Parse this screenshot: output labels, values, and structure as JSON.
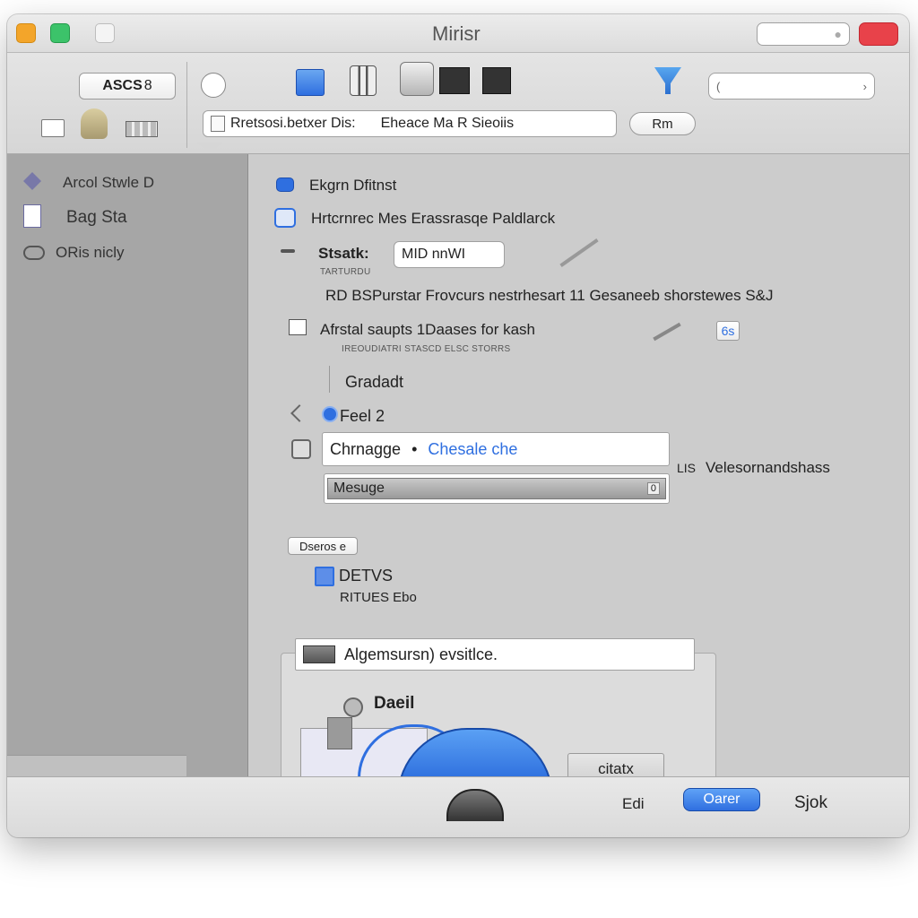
{
  "window": {
    "title": "Mirisr",
    "colors": {
      "accent": "#2f6fe0",
      "close": "#e8424a",
      "minimize": "#f3a52a",
      "zoom": "#3cc36a"
    }
  },
  "toolbar": {
    "asc_button_label": "ASCS",
    "asc_button_suffix": "8",
    "address_text": "Rretsosi.betxer Dis:",
    "address_text_2": "Eheace Ma R Sieoiis",
    "rm_button_label": "Rm",
    "search_placeholder": "",
    "icons": [
      "circle-icon",
      "window-icon",
      "printer-icon",
      "disk-icon",
      "grid-icon",
      "grid-icon",
      "funnel-icon",
      "plug-icon",
      "person-icon",
      "folder-icon"
    ]
  },
  "sidebar": {
    "items": [
      {
        "label": "Arcol Stwle D",
        "icon": "tag-icon"
      },
      {
        "label": "Bag Sta",
        "icon": "document-icon"
      },
      {
        "label": "ORis nicly",
        "icon": "link-icon"
      }
    ]
  },
  "main": {
    "row1_label": "Ekgrn Dfitnst",
    "row2_label": "Hrtcrnrec Mes Erassrasqe Paldlarck",
    "status_label": "Stsatk:",
    "status_field_value": "MID nnWI",
    "small_caption": "TARTURDU",
    "info_line": "RD BSPurstar Frovcurs nestrhesart 11 Gesaneeb shorstewes S&J",
    "checkbox_label": "Afrstal saupts 1Daases for kash",
    "checkbox_sub": "IREOUDIATRI STASCD ELSC STORRS",
    "badge_label": "6s",
    "group_label": "Gradadt",
    "radio_label": "Feel 2",
    "dropdown_prefix": "Chrnagge",
    "dropdown_link": "Chesale che",
    "side_text_prefix": "LIS",
    "side_text": "Velesornandshass",
    "input_value": "Mesuge",
    "input_suffix": "0",
    "section_tag": "Dseros e",
    "option_label": "DETVS",
    "option_sub": "RITUES Ebo"
  },
  "panel": {
    "header_text": "Algemsursn) evsitlce.",
    "item_label": "Daeil",
    "button_label": "citatx"
  },
  "statusbar": {
    "left_label": "Edi",
    "primary_button": "Oarer",
    "right_label": "Sjok"
  }
}
